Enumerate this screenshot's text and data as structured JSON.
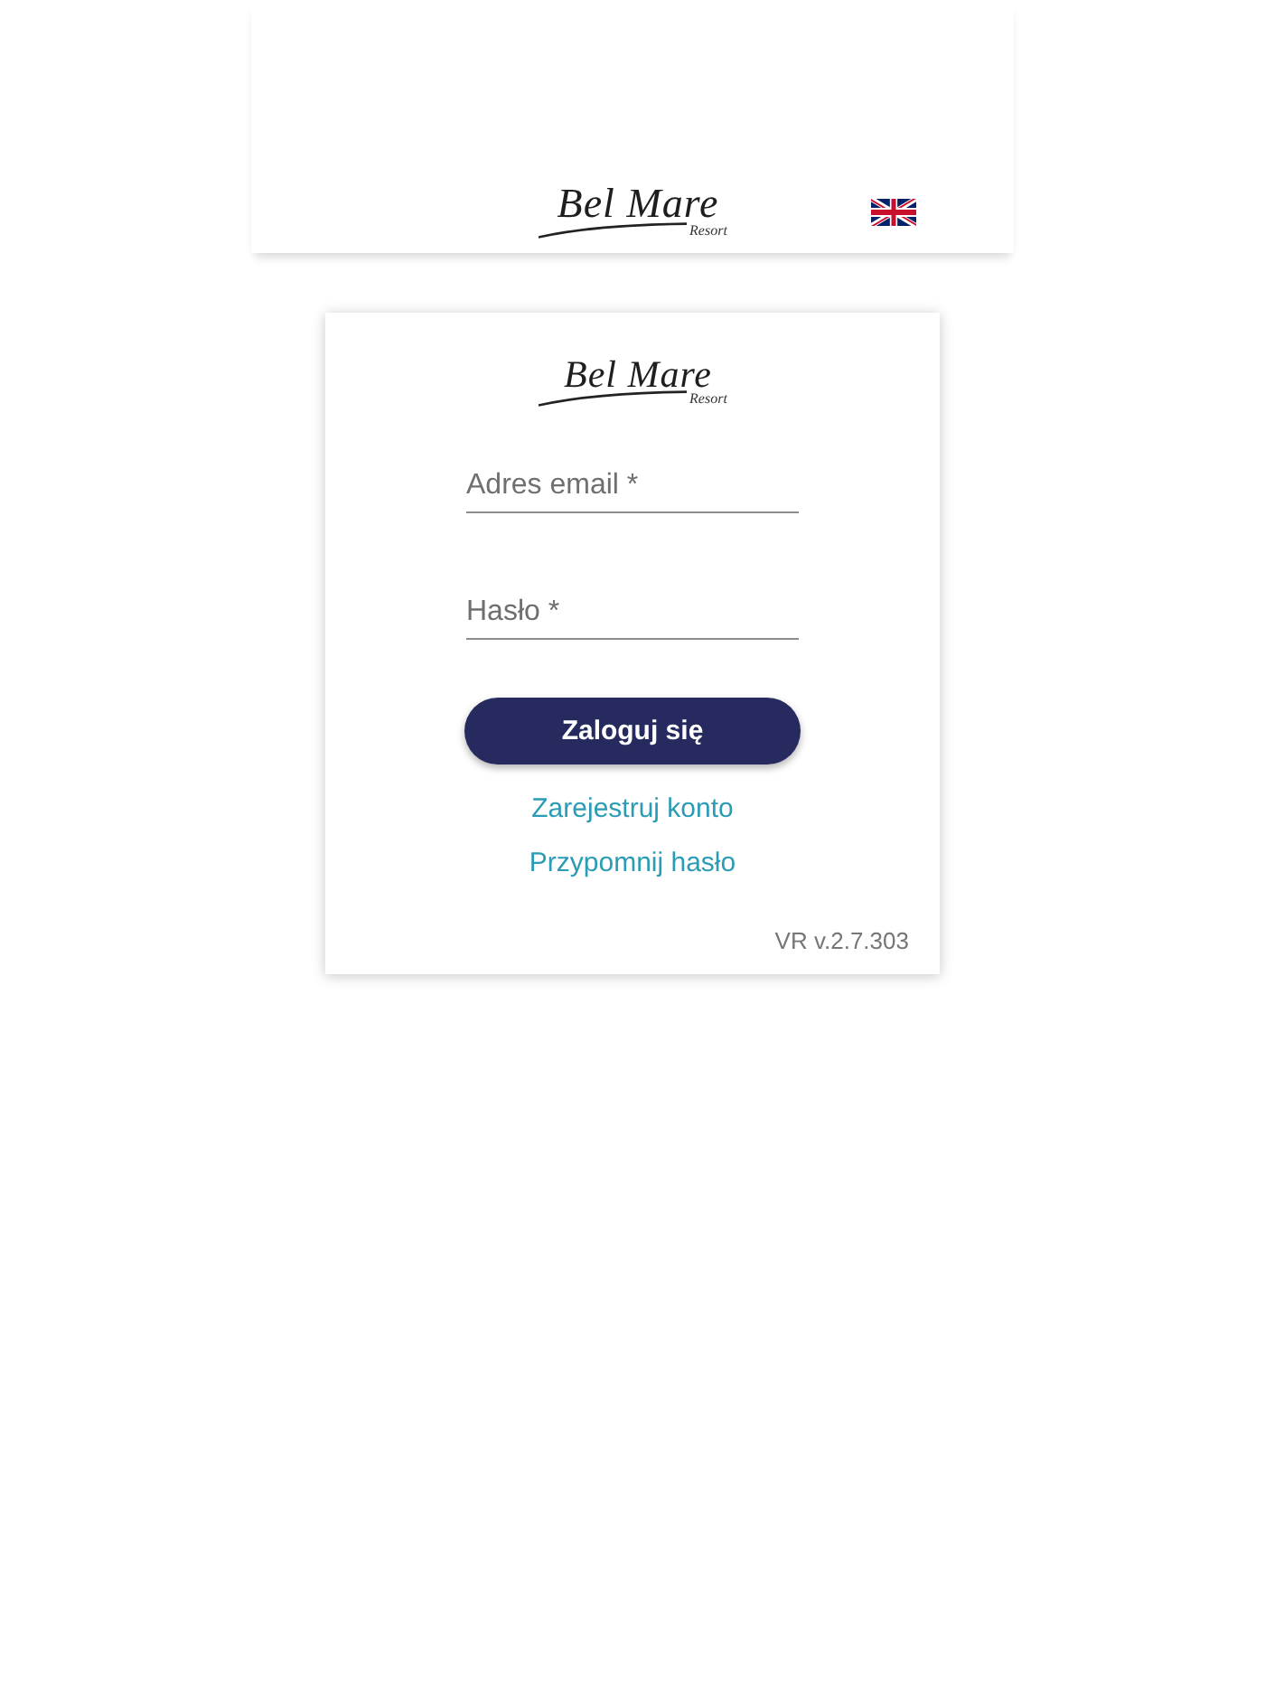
{
  "header": {
    "logo": {
      "name": "Bel Mare",
      "subtitle": "Resort"
    }
  },
  "login_card": {
    "logo": {
      "name": "Bel Mare",
      "subtitle": "Resort"
    },
    "fields": [
      {
        "placeholder": "Adres email *"
      },
      {
        "placeholder": "Hasło *"
      }
    ],
    "submit_button": "Zaloguj się",
    "links": [
      "Zarejestruj konto",
      "Przypomnij hasło"
    ],
    "version": "VR v.2.7.303"
  }
}
